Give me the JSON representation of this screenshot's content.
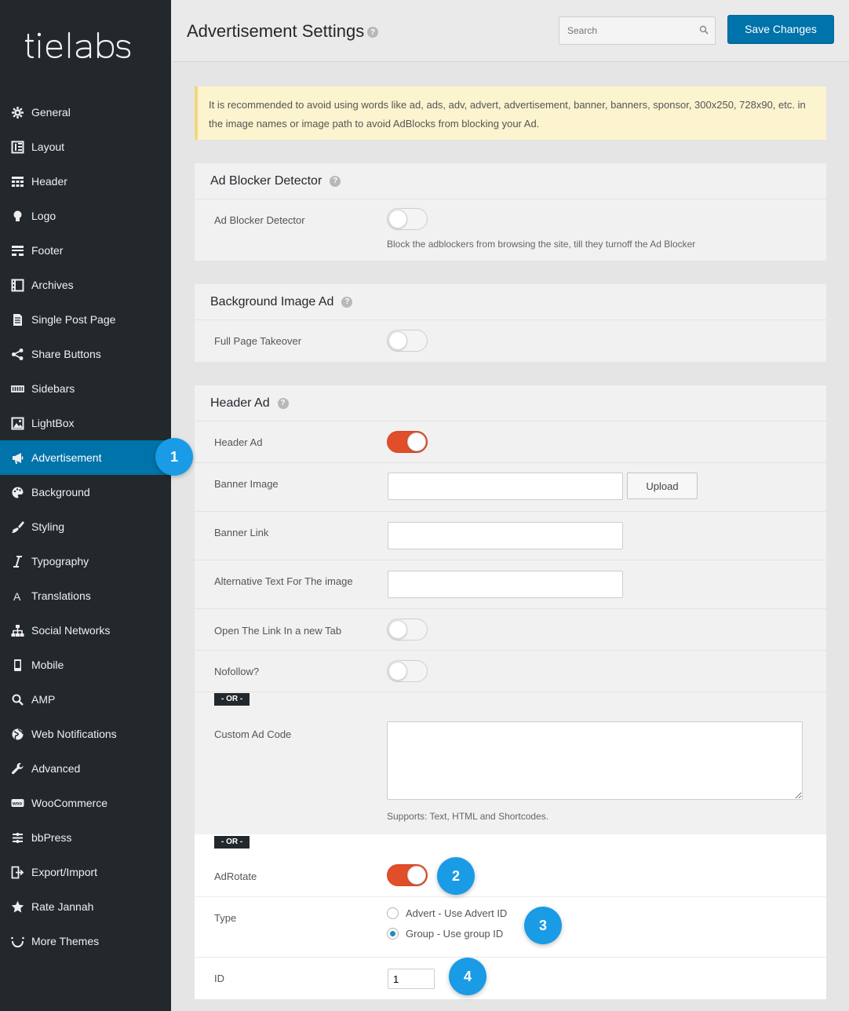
{
  "app": {
    "logo_text": "tielabs",
    "page_title": "Advertisement Settings",
    "search_placeholder": "Search",
    "save_label": "Save Changes"
  },
  "sidebar": {
    "items": [
      {
        "label": "General",
        "icon": "gear-icon"
      },
      {
        "label": "Layout",
        "icon": "layout-icon"
      },
      {
        "label": "Header",
        "icon": "header-icon"
      },
      {
        "label": "Logo",
        "icon": "lightbulb-icon"
      },
      {
        "label": "Footer",
        "icon": "footer-icon"
      },
      {
        "label": "Archives",
        "icon": "archives-icon"
      },
      {
        "label": "Single Post Page",
        "icon": "document-icon"
      },
      {
        "label": "Share Buttons",
        "icon": "share-icon"
      },
      {
        "label": "Sidebars",
        "icon": "sidebars-icon"
      },
      {
        "label": "LightBox",
        "icon": "image-icon"
      },
      {
        "label": "Advertisement",
        "icon": "megaphone-icon",
        "active": true
      },
      {
        "label": "Background",
        "icon": "paint-icon"
      },
      {
        "label": "Styling",
        "icon": "brush-icon"
      },
      {
        "label": "Typography",
        "icon": "italic-icon"
      },
      {
        "label": "Translations",
        "icon": "translation-icon"
      },
      {
        "label": "Social Networks",
        "icon": "network-icon"
      },
      {
        "label": "Mobile",
        "icon": "mobile-icon"
      },
      {
        "label": "AMP",
        "icon": "search-icon"
      },
      {
        "label": "Web Notifications",
        "icon": "globe-icon"
      },
      {
        "label": "Advanced",
        "icon": "wrench-icon"
      },
      {
        "label": "WooCommerce",
        "icon": "woocommerce-icon"
      },
      {
        "label": "bbPress",
        "icon": "bbpress-icon"
      },
      {
        "label": "Export/Import",
        "icon": "export-icon"
      },
      {
        "label": "Rate Jannah",
        "icon": "star-icon"
      },
      {
        "label": "More Themes",
        "icon": "smile-icon"
      }
    ]
  },
  "notice": "It is recommended to avoid using words like ad, ads, adv, advert, advertisement, banner, banners, sponsor, 300x250, 728x90, etc. in the image names or image path to avoid AdBlocks from blocking your Ad.",
  "sections": {
    "ad_blocker": {
      "title": "Ad Blocker Detector",
      "label": "Ad Blocker Detector",
      "enabled": false,
      "description": "Block the adblockers from browsing the site, till they turnoff the Ad Blocker"
    },
    "background_ad": {
      "title": "Background Image Ad",
      "label": "Full Page Takeover",
      "enabled": false
    },
    "header_ad": {
      "title": "Header Ad",
      "header_ad_label": "Header Ad",
      "header_ad_enabled": true,
      "banner_image_label": "Banner Image",
      "banner_image_value": "",
      "upload_label": "Upload",
      "banner_link_label": "Banner Link",
      "banner_link_value": "",
      "alt_text_label": "Alternative Text For The image",
      "alt_text_value": "",
      "new_tab_label": "Open The Link In a new Tab",
      "new_tab_enabled": false,
      "nofollow_label": "Nofollow?",
      "nofollow_enabled": false,
      "or_label": "- OR -",
      "custom_code_label": "Custom Ad Code",
      "custom_code_value": "",
      "custom_code_desc": "Supports: Text, HTML and Shortcodes.",
      "or_label_2": "- OR -",
      "adrotate_label": "AdRotate",
      "adrotate_enabled": true,
      "type_label": "Type",
      "type_options": [
        "Advert - Use Advert ID",
        "Group - Use group ID"
      ],
      "type_selected": "Group - Use group ID",
      "id_label": "ID",
      "id_value": "1"
    }
  },
  "callouts": [
    "1",
    "2",
    "3",
    "4"
  ],
  "colors": {
    "sidebar_bg": "#23282d",
    "accent": "#0073aa",
    "toggle_on": "#e04e2a",
    "callout": "#1a9be6"
  }
}
